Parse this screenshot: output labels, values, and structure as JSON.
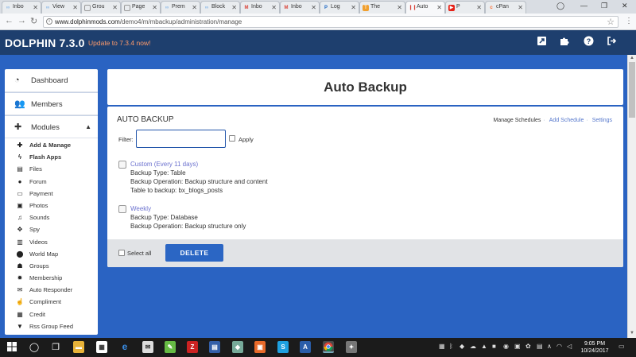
{
  "browser": {
    "tabs": [
      {
        "label": "Inbo",
        "icon": "infinity-icon",
        "color": "#6aa7e6"
      },
      {
        "label": "View",
        "icon": "infinity-icon",
        "color": "#6aa7e6"
      },
      {
        "label": "Grou",
        "icon": "page-icon",
        "color": "#999999"
      },
      {
        "label": "Page",
        "icon": "page-icon",
        "color": "#999999"
      },
      {
        "label": "Prem",
        "icon": "infinity-icon",
        "color": "#6aa7e6"
      },
      {
        "label": "Block",
        "icon": "infinity-icon",
        "color": "#6aa7e6"
      },
      {
        "label": "Inbo",
        "icon": "gmail-icon",
        "color": "#d9443a"
      },
      {
        "label": "Inbo",
        "icon": "gmail-icon",
        "color": "#d9443a"
      },
      {
        "label": "Log",
        "icon": "paypal-icon",
        "color": "#1f67c3"
      },
      {
        "label": "The",
        "icon": "site-icon",
        "color": "#f0a030"
      },
      {
        "label": "Auto",
        "icon": "dolphin-icon",
        "color": "#d9443a",
        "active": true
      },
      {
        "label": "P",
        "icon": "youtube-icon",
        "color": "#e62117"
      },
      {
        "label": "cPan",
        "icon": "cpanel-icon",
        "color": "#ff6c2c"
      }
    ],
    "url_host": "www.dolphinmods.com",
    "url_path": "/demo4/m/mbackup/administration/manage"
  },
  "header": {
    "brand": "DOLPHIN 7.3.0",
    "update_link": "Update to 7.3.4 now!"
  },
  "sidebar": {
    "main_items": [
      {
        "label": "Dashboard",
        "icon": "dashboard-icon"
      },
      {
        "label": "Members",
        "icon": "users-icon"
      },
      {
        "label": "Modules",
        "icon": "puzzle-icon"
      }
    ],
    "module_items": [
      {
        "label": "Add & Manage",
        "icon": "plus-icon",
        "bold": true
      },
      {
        "label": "Flash Apps",
        "icon": "bolt-icon",
        "bold": true
      },
      {
        "label": "Files",
        "icon": "file-icon"
      },
      {
        "label": "Forum",
        "icon": "comments-icon"
      },
      {
        "label": "Payment",
        "icon": "credit-card-icon"
      },
      {
        "label": "Photos",
        "icon": "photo-icon"
      },
      {
        "label": "Sounds",
        "icon": "music-icon"
      },
      {
        "label": "Spy",
        "icon": "crosshair-icon"
      },
      {
        "label": "Videos",
        "icon": "film-icon"
      },
      {
        "label": "World Map",
        "icon": "map-marker-icon"
      },
      {
        "label": "Groups",
        "icon": "users-icon"
      },
      {
        "label": "Membership",
        "icon": "certificate-icon"
      },
      {
        "label": "Auto Responder",
        "icon": "envelope-icon"
      },
      {
        "label": "Compliment",
        "icon": "thumbs-up-icon"
      },
      {
        "label": "Credit",
        "icon": "money-icon"
      },
      {
        "label": "Rss Group Feed",
        "icon": "filter-icon"
      }
    ]
  },
  "main": {
    "page_title": "Auto Backup",
    "section_title": "AUTO BACKUP",
    "links": {
      "manage": "Manage Schedules",
      "add": "Add Schedule",
      "settings": "Settings"
    },
    "filter_label": "Filter:",
    "filter_value": "",
    "apply_label": "Apply",
    "schedules": [
      {
        "name": "Custom (Every 11 days)",
        "type": "Backup Type: Table",
        "operation": "Backup Operation: Backup structure and content",
        "table": "Table to backup: bx_blogs_posts"
      },
      {
        "name": "Weekly",
        "type": "Backup Type: Database",
        "operation": "Backup Operation: Backup structure only"
      }
    ],
    "select_all_label": "Select all",
    "delete_label": "DELETE"
  },
  "taskbar": {
    "time": "9:05 PM",
    "date": "10/24/2017"
  },
  "colors": {
    "header_bg": "#1e3f6e",
    "page_bg": "#2a63c2",
    "accent": "#2b66c4",
    "update_text": "#ff9b6b",
    "link": "#6c72cf"
  }
}
